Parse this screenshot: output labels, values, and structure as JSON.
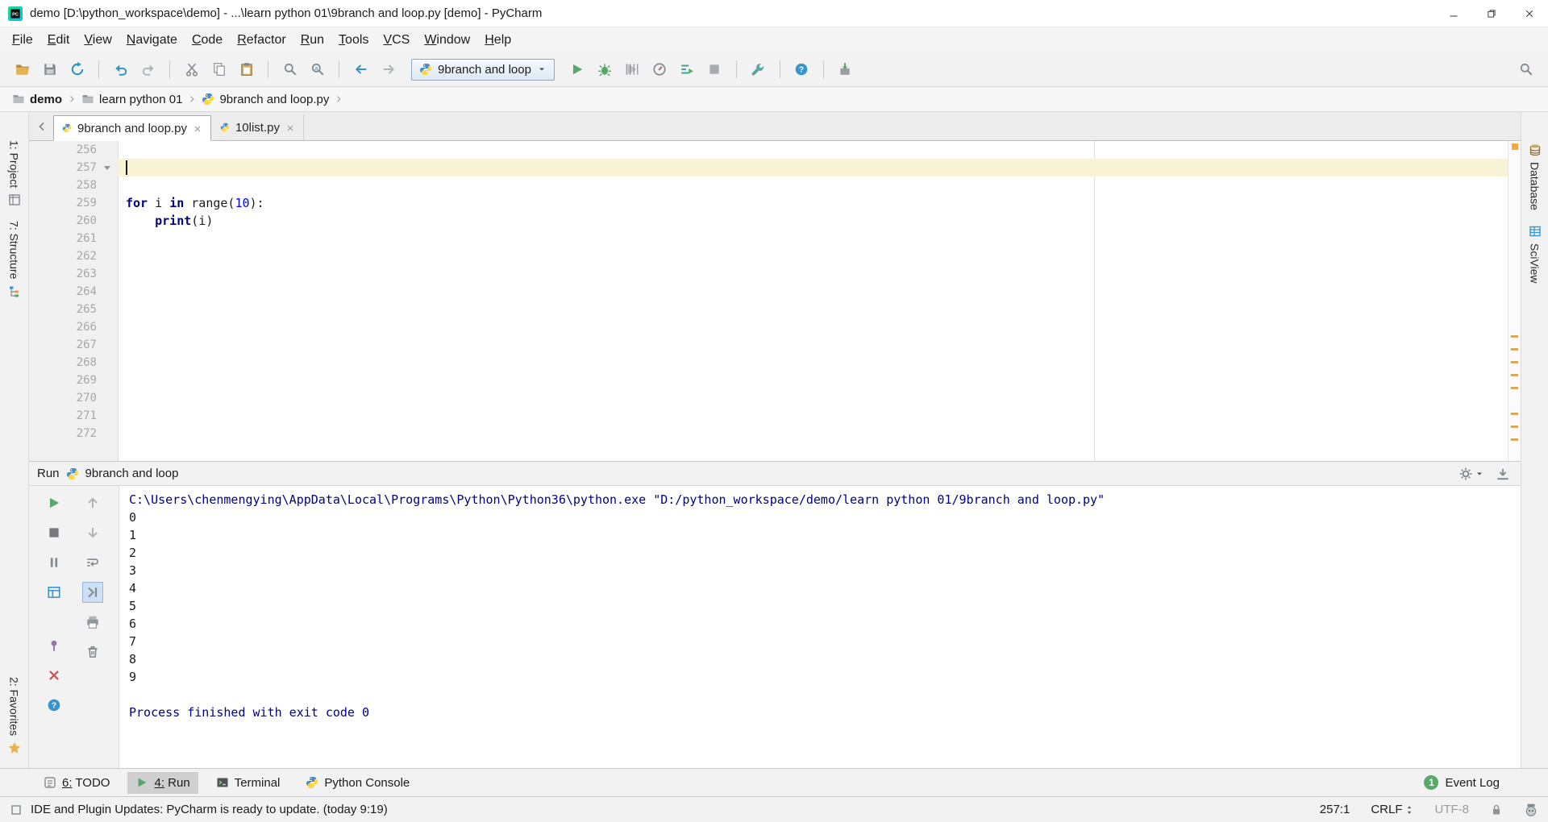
{
  "colors": {
    "kw": "#000080",
    "num": "#0000FF",
    "sys": "#000080",
    "green": "#59A869",
    "current_line": "#F8F3D4",
    "mark": "#DBA95D"
  },
  "window": {
    "title": "demo [D:\\python_workspace\\demo] - ...\\learn python 01\\9branch and loop.py [demo] - PyCharm",
    "controls": [
      "minimize",
      "maximize",
      "close"
    ]
  },
  "menu": {
    "items": [
      "File",
      "Edit",
      "View",
      "Navigate",
      "Code",
      "Refactor",
      "Run",
      "Tools",
      "VCS",
      "Window",
      "Help"
    ]
  },
  "toolbar": {
    "groups_before": [
      [
        "open",
        "save",
        "sync"
      ],
      [
        "undo",
        "redo"
      ],
      [
        "cut",
        "copy",
        "paste"
      ],
      [
        "find",
        "replace"
      ],
      [
        "back",
        "forward"
      ]
    ],
    "run_config": "9branch and loop",
    "groups_after": [
      [
        "run",
        "debug",
        "coverage",
        "profiler",
        "run-console",
        "stop"
      ],
      [
        "tools"
      ],
      [
        "help"
      ],
      [
        "update"
      ]
    ]
  },
  "breadcrumbs": [
    "demo",
    "learn python 01",
    "9branch and loop.py"
  ],
  "editor_tabs": [
    {
      "label": "9branch and loop.py",
      "active": true
    },
    {
      "label": "10list.py",
      "active": false
    }
  ],
  "left_stripe": {
    "project": "1: Project",
    "structure": "7: Structure",
    "favorites": "2: Favorites"
  },
  "right_stripe": {
    "database": "Database",
    "sciview": "SciView"
  },
  "editor": {
    "current_line": 257,
    "stripe_marks": [
      241,
      257,
      273,
      289,
      305,
      337,
      353,
      369
    ],
    "lines": [
      {
        "num": 256,
        "tokens": []
      },
      {
        "num": 257,
        "tokens": [],
        "current": true,
        "fold": true
      },
      {
        "num": 258,
        "tokens": []
      },
      {
        "num": 259,
        "tokens": [
          {
            "t": "for ",
            "c": "kw"
          },
          {
            "t": "i ",
            "c": ""
          },
          {
            "t": "in ",
            "c": "kw"
          },
          {
            "t": "range(",
            "c": ""
          },
          {
            "t": "10",
            "c": "num"
          },
          {
            "t": "):",
            "c": ""
          }
        ]
      },
      {
        "num": 260,
        "tokens": [
          {
            "t": "    ",
            "c": ""
          },
          {
            "t": "print",
            "c": "kw"
          },
          {
            "t": "(i)",
            "c": ""
          }
        ]
      },
      {
        "num": 261,
        "tokens": []
      },
      {
        "num": 262,
        "tokens": []
      },
      {
        "num": 263,
        "tokens": []
      },
      {
        "num": 264,
        "tokens": []
      },
      {
        "num": 265,
        "tokens": []
      },
      {
        "num": 266,
        "tokens": []
      },
      {
        "num": 267,
        "tokens": []
      },
      {
        "num": 268,
        "tokens": []
      },
      {
        "num": 269,
        "tokens": []
      },
      {
        "num": 270,
        "tokens": []
      },
      {
        "num": 271,
        "tokens": []
      },
      {
        "num": 272,
        "tokens": []
      }
    ]
  },
  "run_panel": {
    "title": "Run",
    "config_name": "9branch and loop",
    "toolbar_col1": [
      "rerun",
      "stop-dark",
      "pause",
      "restore-layout",
      "spacer",
      "pin",
      "close",
      "help-small"
    ],
    "toolbar_col2": [
      "up",
      "down",
      "soft-wrap",
      "scroll-end",
      "print",
      "trash"
    ],
    "active_tool": "scroll-end",
    "console_lines": [
      {
        "type": "sys",
        "text": "C:\\Users\\chenmengying\\AppData\\Local\\Programs\\Python\\Python36\\python.exe \"D:/python_workspace/demo/learn python 01/9branch and loop.py\""
      },
      {
        "type": "out",
        "text": "0"
      },
      {
        "type": "out",
        "text": "1"
      },
      {
        "type": "out",
        "text": "2"
      },
      {
        "type": "out",
        "text": "3"
      },
      {
        "type": "out",
        "text": "4"
      },
      {
        "type": "out",
        "text": "5"
      },
      {
        "type": "out",
        "text": "6"
      },
      {
        "type": "out",
        "text": "7"
      },
      {
        "type": "out",
        "text": "8"
      },
      {
        "type": "out",
        "text": "9"
      },
      {
        "type": "out",
        "text": ""
      },
      {
        "type": "sys",
        "text": "Process finished with exit code 0"
      }
    ]
  },
  "bottom_bar": {
    "buttons": [
      {
        "label": "6: TODO",
        "icon": "todo",
        "active": false,
        "underline": true
      },
      {
        "label": "4: Run",
        "icon": "run-small",
        "active": true,
        "underline": true
      },
      {
        "label": "Terminal",
        "icon": "terminal",
        "active": false,
        "underline": false
      },
      {
        "label": "Python Console",
        "icon": "python",
        "active": false,
        "underline": false
      }
    ],
    "event_log": {
      "label": "Event Log",
      "badge": "1"
    }
  },
  "status_bar": {
    "message": "IDE and Plugin Updates: PyCharm is ready to update. (today 9:19)",
    "caret_position": "257:1",
    "line_separator": "CRLF",
    "encoding": "UTF-8",
    "icons": [
      "background-tasks",
      "lock",
      "inspections-profile"
    ]
  }
}
